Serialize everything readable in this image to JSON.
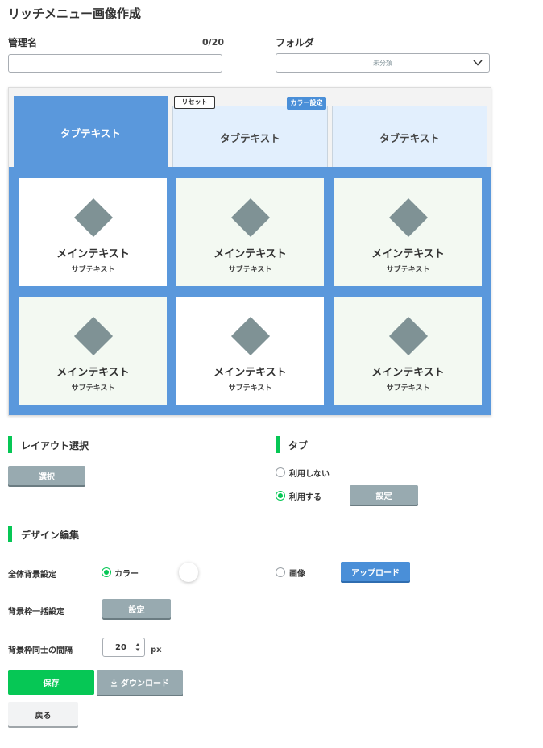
{
  "page": {
    "title": "リッチメニュー画像作成"
  },
  "form": {
    "name_label": "管理名",
    "name_counter": "0/20",
    "name_value": "",
    "folder_label": "フォルダ",
    "folder_value": "未分類"
  },
  "preview": {
    "tabs": [
      {
        "label": "タブテキスト",
        "active": true
      },
      {
        "label": "タブテキスト",
        "active": false
      },
      {
        "label": "タブテキスト",
        "active": false
      }
    ],
    "reset_label": "リセット",
    "color_label": "カラー設定",
    "cells": [
      {
        "main": "メインテキスト",
        "sub": "サブテキスト"
      },
      {
        "main": "メインテキスト",
        "sub": "サブテキスト"
      },
      {
        "main": "メインテキスト",
        "sub": "サブテキスト"
      },
      {
        "main": "メインテキスト",
        "sub": "サブテキスト"
      },
      {
        "main": "メインテキスト",
        "sub": "サブテキスト"
      },
      {
        "main": "メインテキスト",
        "sub": "サブテキスト"
      }
    ]
  },
  "layout": {
    "title": "レイアウト選択",
    "select_label": "選択"
  },
  "tab_section": {
    "title": "タブ",
    "option_off": "利用しない",
    "option_on": "利用する",
    "selected": "on",
    "settings_label": "設定"
  },
  "design": {
    "title": "デザイン編集",
    "bg_label": "全体背景設定",
    "bg_color_option": "カラー",
    "bg_image_option": "画像",
    "upload_label": "アップロード",
    "frame_label": "背景枠一括設定",
    "frame_settings_label": "設定",
    "gap_label": "背景枠同士の間隔",
    "gap_value": "20",
    "gap_unit": "px"
  },
  "actions": {
    "save_label": "保存",
    "download_label": "ダウンロード",
    "back_label": "戻る"
  },
  "colors": {
    "accent_green": "#06c755",
    "tab_blue": "#5a98dc",
    "button_blue": "#4a8fd8",
    "button_gray": "#98aab0",
    "icon_gray": "#7f9295"
  }
}
